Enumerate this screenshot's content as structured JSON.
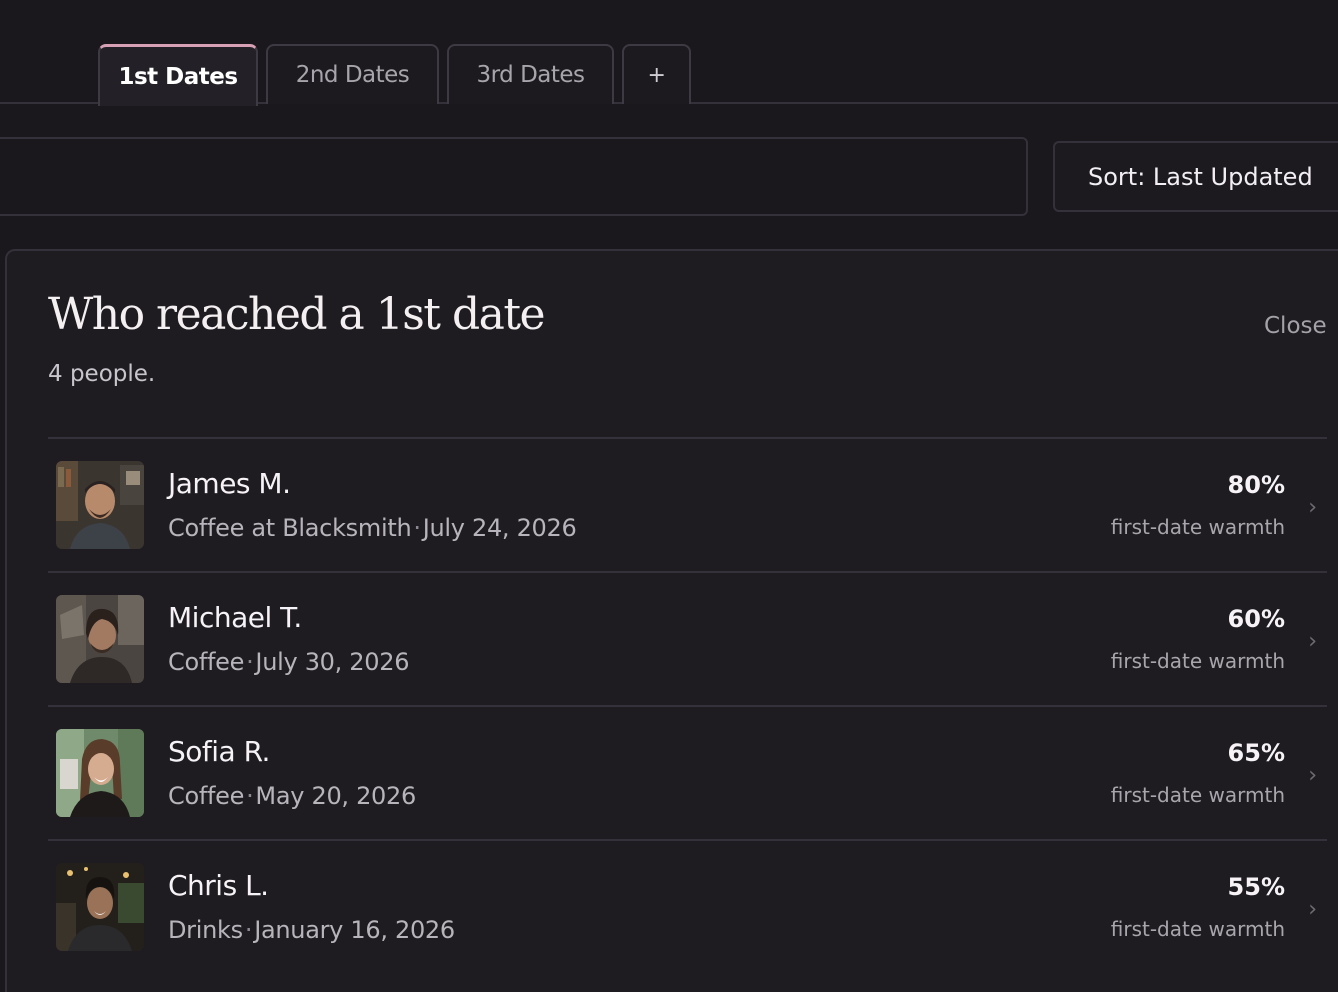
{
  "tabs": [
    {
      "label": "1st Dates",
      "active": true
    },
    {
      "label": "2nd Dates",
      "active": false
    },
    {
      "label": "3rd Dates",
      "active": false
    },
    {
      "label": "+",
      "active": false
    }
  ],
  "search": {
    "placeholder": ""
  },
  "sort": {
    "label": "Sort: Last Updated"
  },
  "panel": {
    "title": "Who reached a 1st date",
    "count": "4 people.",
    "close_label": "Close"
  },
  "people": [
    {
      "name": "James M.",
      "venue": "Coffee at Blacksmith",
      "separator": "·",
      "date": "July 24, 2026",
      "percent": "80%",
      "caption": "first-date warmth",
      "chevron": "›"
    },
    {
      "name": "Michael T.",
      "venue": "Coffee",
      "separator": "·",
      "date": "July 30, 2026",
      "percent": "60%",
      "caption": "first-date warmth",
      "chevron": "›"
    },
    {
      "name": "Sofia R.",
      "venue": "Coffee",
      "separator": "·",
      "date": "May 20, 2026",
      "percent": "65%",
      "caption": "first-date warmth",
      "chevron": "›"
    },
    {
      "name": "Chris L.",
      "venue": "Drinks",
      "separator": "·",
      "date": "January 16, 2026",
      "percent": "55%",
      "caption": "first-date warmth",
      "chevron": "›"
    }
  ],
  "colors": {
    "background": "#1a181d",
    "active_tab_accent": "#d7a0b4",
    "border": "#34313a"
  }
}
